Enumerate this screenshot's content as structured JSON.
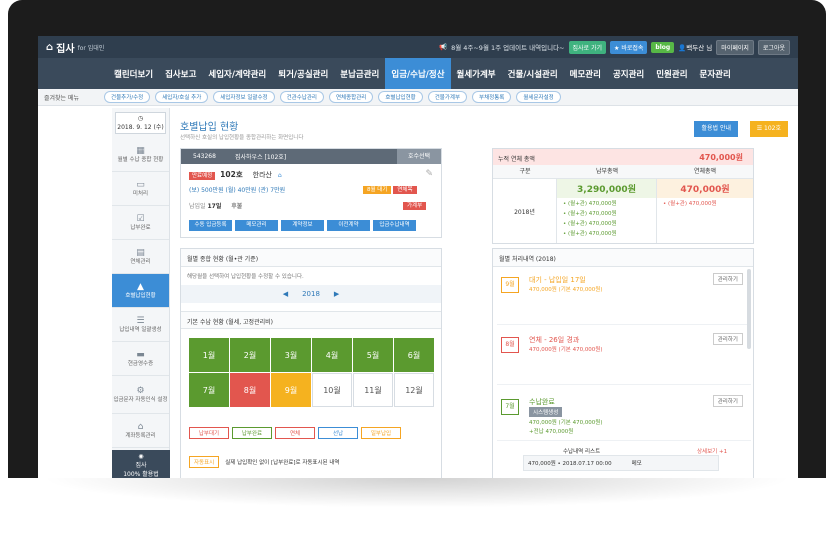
{
  "topbar": {
    "logo": "집사",
    "logo_sub": "for 임대인",
    "notice": "8월 4주~9월 1주 업데이트 내역입니다~",
    "btn_go": "집사로 가기",
    "btn_bookmark": "바로접속",
    "btn_blog": "blog",
    "user": "백두산 님",
    "btn_mypage": "마이페이지",
    "btn_logout": "로그아웃"
  },
  "mainnav": [
    "캘린더보기",
    "집사보고",
    "세입자/계약관리",
    "퇴거/공실관리",
    "분납금관리",
    "입금/수납/정산",
    "월세가계부",
    "건물/시설관리",
    "메모관리",
    "공지관리",
    "민원관리",
    "문자관리"
  ],
  "mainnav_active_index": 5,
  "subnav": {
    "fav_label": "즐겨찾는 메뉴",
    "pills": [
      "건물추가/수정",
      "세입자/호실 추가",
      "세입자정보 일괄수정",
      "건관수납관리",
      "연체종합관리",
      "호별납입현황",
      "건물가계부",
      "부채정통록",
      "월세문자설정"
    ]
  },
  "sidebar": {
    "date": "2018. 9. 12 (수)",
    "items": [
      {
        "label": "월별 수납 종합 현황",
        "icon": "calendar-icon"
      },
      {
        "label": "미처리",
        "icon": "inbox-icon"
      },
      {
        "label": "납부완료",
        "icon": "checkbox-icon"
      },
      {
        "label": "연체관리",
        "icon": "document-icon"
      },
      {
        "label": "호별납입현황",
        "icon": "chart-icon"
      },
      {
        "label": "납입내역 일괄생성",
        "icon": "list-icon"
      },
      {
        "label": "현금영수증",
        "icon": "receipt-icon"
      },
      {
        "label": "입금문자 자동인식 설정",
        "icon": "settings-icon"
      },
      {
        "label": "계좌등록관리",
        "icon": "bank-icon"
      }
    ],
    "active_index": 4,
    "bottom_label": "집사",
    "bottom_sub": "100% 활용법"
  },
  "page": {
    "title": "호별납입 현황",
    "desc": "선택하신 호실의 납입현황을 종합관리하는 화면입니다",
    "btn_guide": "활용법 안내",
    "btn_count": "102호"
  },
  "unit": {
    "num": "543268",
    "name": "집사하우스 [102호]",
    "select": "호수선택",
    "status_tag": "만료예정",
    "room": "102호",
    "tenant": "한라산",
    "amounts": "(보) 500만원 (월) 40만원 (관) 7만원",
    "tag_overdue": "8월 대기",
    "tag_overdue2": "연체목",
    "pay_day_label": "납입일",
    "pay_day": "17일",
    "pay_type": "후불",
    "tag_ledger": "가계부",
    "actions": [
      "수동 입금등록",
      "메모관리",
      "계약정보",
      "이전계약",
      "입금수납내역"
    ]
  },
  "calendar": {
    "section_title": "월별 종합 현황 (월•관 기준)",
    "note": "해당월을 선택하여 납입현황을 수정할 수 있습니다.",
    "year": "2018",
    "month_section": "기본 수납 현황 (월세, 고정관리비)",
    "months": [
      {
        "label": "1월",
        "state": "paid"
      },
      {
        "label": "2월",
        "state": "paid"
      },
      {
        "label": "3월",
        "state": "paid"
      },
      {
        "label": "4월",
        "state": "paid"
      },
      {
        "label": "5월",
        "state": "paid"
      },
      {
        "label": "6월",
        "state": "paid"
      },
      {
        "label": "7월",
        "state": "paid"
      },
      {
        "label": "8월",
        "state": "overdue"
      },
      {
        "label": "9월",
        "state": "waiting"
      },
      {
        "label": "10월",
        "state": "empty"
      },
      {
        "label": "11월",
        "state": "empty"
      },
      {
        "label": "12월",
        "state": "empty"
      }
    ],
    "legend": [
      "납부대기",
      "납부완료",
      "연체",
      "선납",
      "일부납입"
    ],
    "auto_label": "자동표시",
    "auto_text": "실제 납입확인 없이 [납부완료]로 자동표시된 내역"
  },
  "summary": {
    "label": "누적 연체 총액",
    "total": "470,000원",
    "col_year": "구분",
    "col_paid": "납부총액",
    "col_over": "연체총액",
    "year": "2018년",
    "paid_total": "3,290,000원",
    "over_total": "470,000원",
    "paid_items": [
      "• (월+관) 470,000원",
      "• (월+관) 470,000원",
      "• (월+관) 470,000원",
      "• (월+관) 470,000원"
    ],
    "over_items": [
      "• (월+관) 470,000원"
    ]
  },
  "history": {
    "title": "월별 처리내역 (2018)",
    "items": [
      {
        "month": "9월",
        "title": "대기 - 납입일 17일",
        "sub": "470,000원 (기본 470,000원)",
        "btn": "관리하기",
        "color": "#f5a523"
      },
      {
        "month": "8월",
        "title": "연체 - 26일 경과",
        "sub": "470,000원 (기본 470,000원)",
        "btn": "관리하기",
        "color": "#e2564e"
      },
      {
        "month": "7월",
        "title": "수납완료",
        "sub": "470,000원 (기본 470,000원)",
        "btn": "관리하기",
        "color": "#5b9a2f",
        "tag": "시스템생성",
        "extra": "+전납 470,000원"
      }
    ],
    "receipt_title": "수납내역 리스트",
    "receipt_link": "상세보기 +1",
    "receipt_row": "470,000원 • 2018.07.17 00:00",
    "receipt_memo": "메모"
  }
}
